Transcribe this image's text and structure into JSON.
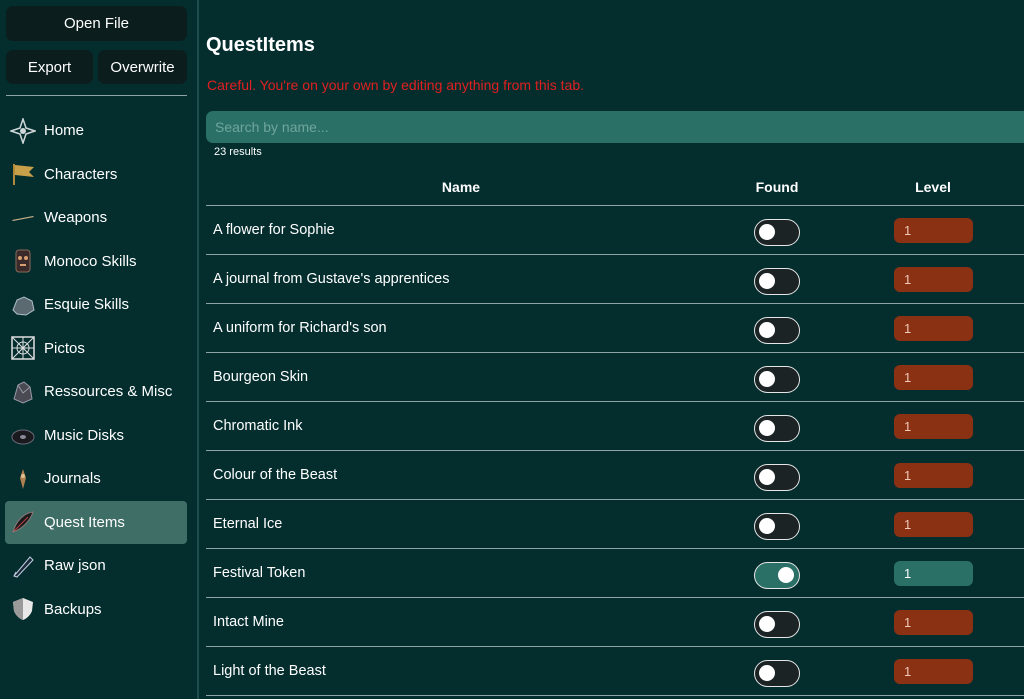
{
  "toolbar": {
    "open_file": "Open File",
    "export": "Export",
    "overwrite": "Overwrite"
  },
  "nav": [
    {
      "label": "Home",
      "icon": "compass-icon"
    },
    {
      "label": "Characters",
      "icon": "banner-icon"
    },
    {
      "label": "Weapons",
      "icon": "sword-icon"
    },
    {
      "label": "Monoco Skills",
      "icon": "mask-icon"
    },
    {
      "label": "Esquie Skills",
      "icon": "rock-icon"
    },
    {
      "label": "Pictos",
      "icon": "web-icon"
    },
    {
      "label": "Ressources & Misc",
      "icon": "crystal-icon"
    },
    {
      "label": "Music Disks",
      "icon": "disk-icon"
    },
    {
      "label": "Journals",
      "icon": "quill-icon"
    },
    {
      "label": "Quest Items",
      "icon": "feather-icon",
      "active": true
    },
    {
      "label": "Raw json",
      "icon": "pen-icon"
    },
    {
      "label": "Backups",
      "icon": "shield-icon"
    }
  ],
  "page": {
    "title": "QuestItems",
    "warning": "Careful. You're on your own by editing anything from this tab.",
    "search_placeholder": "Search by name...",
    "results": "23 results"
  },
  "table": {
    "headers": {
      "name": "Name",
      "found": "Found",
      "level": "Level"
    },
    "rows": [
      {
        "name": "A flower for Sophie",
        "found": false,
        "level": "1"
      },
      {
        "name": "A journal from Gustave's apprentices",
        "found": false,
        "level": "1"
      },
      {
        "name": "A uniform for Richard's son",
        "found": false,
        "level": "1"
      },
      {
        "name": "Bourgeon Skin",
        "found": false,
        "level": "1"
      },
      {
        "name": "Chromatic Ink",
        "found": false,
        "level": "1"
      },
      {
        "name": "Colour of the Beast",
        "found": false,
        "level": "1"
      },
      {
        "name": "Eternal Ice",
        "found": false,
        "level": "1"
      },
      {
        "name": "Festival Token",
        "found": true,
        "level": "1"
      },
      {
        "name": "Intact Mine",
        "found": false,
        "level": "1"
      },
      {
        "name": "Light of the Beast",
        "found": false,
        "level": "1"
      }
    ]
  },
  "colors": {
    "background": "#042d2e",
    "accent": "#2a7066",
    "warning": "#e02020",
    "level_off": "#8a3113",
    "active_nav": "#3f6e66"
  }
}
